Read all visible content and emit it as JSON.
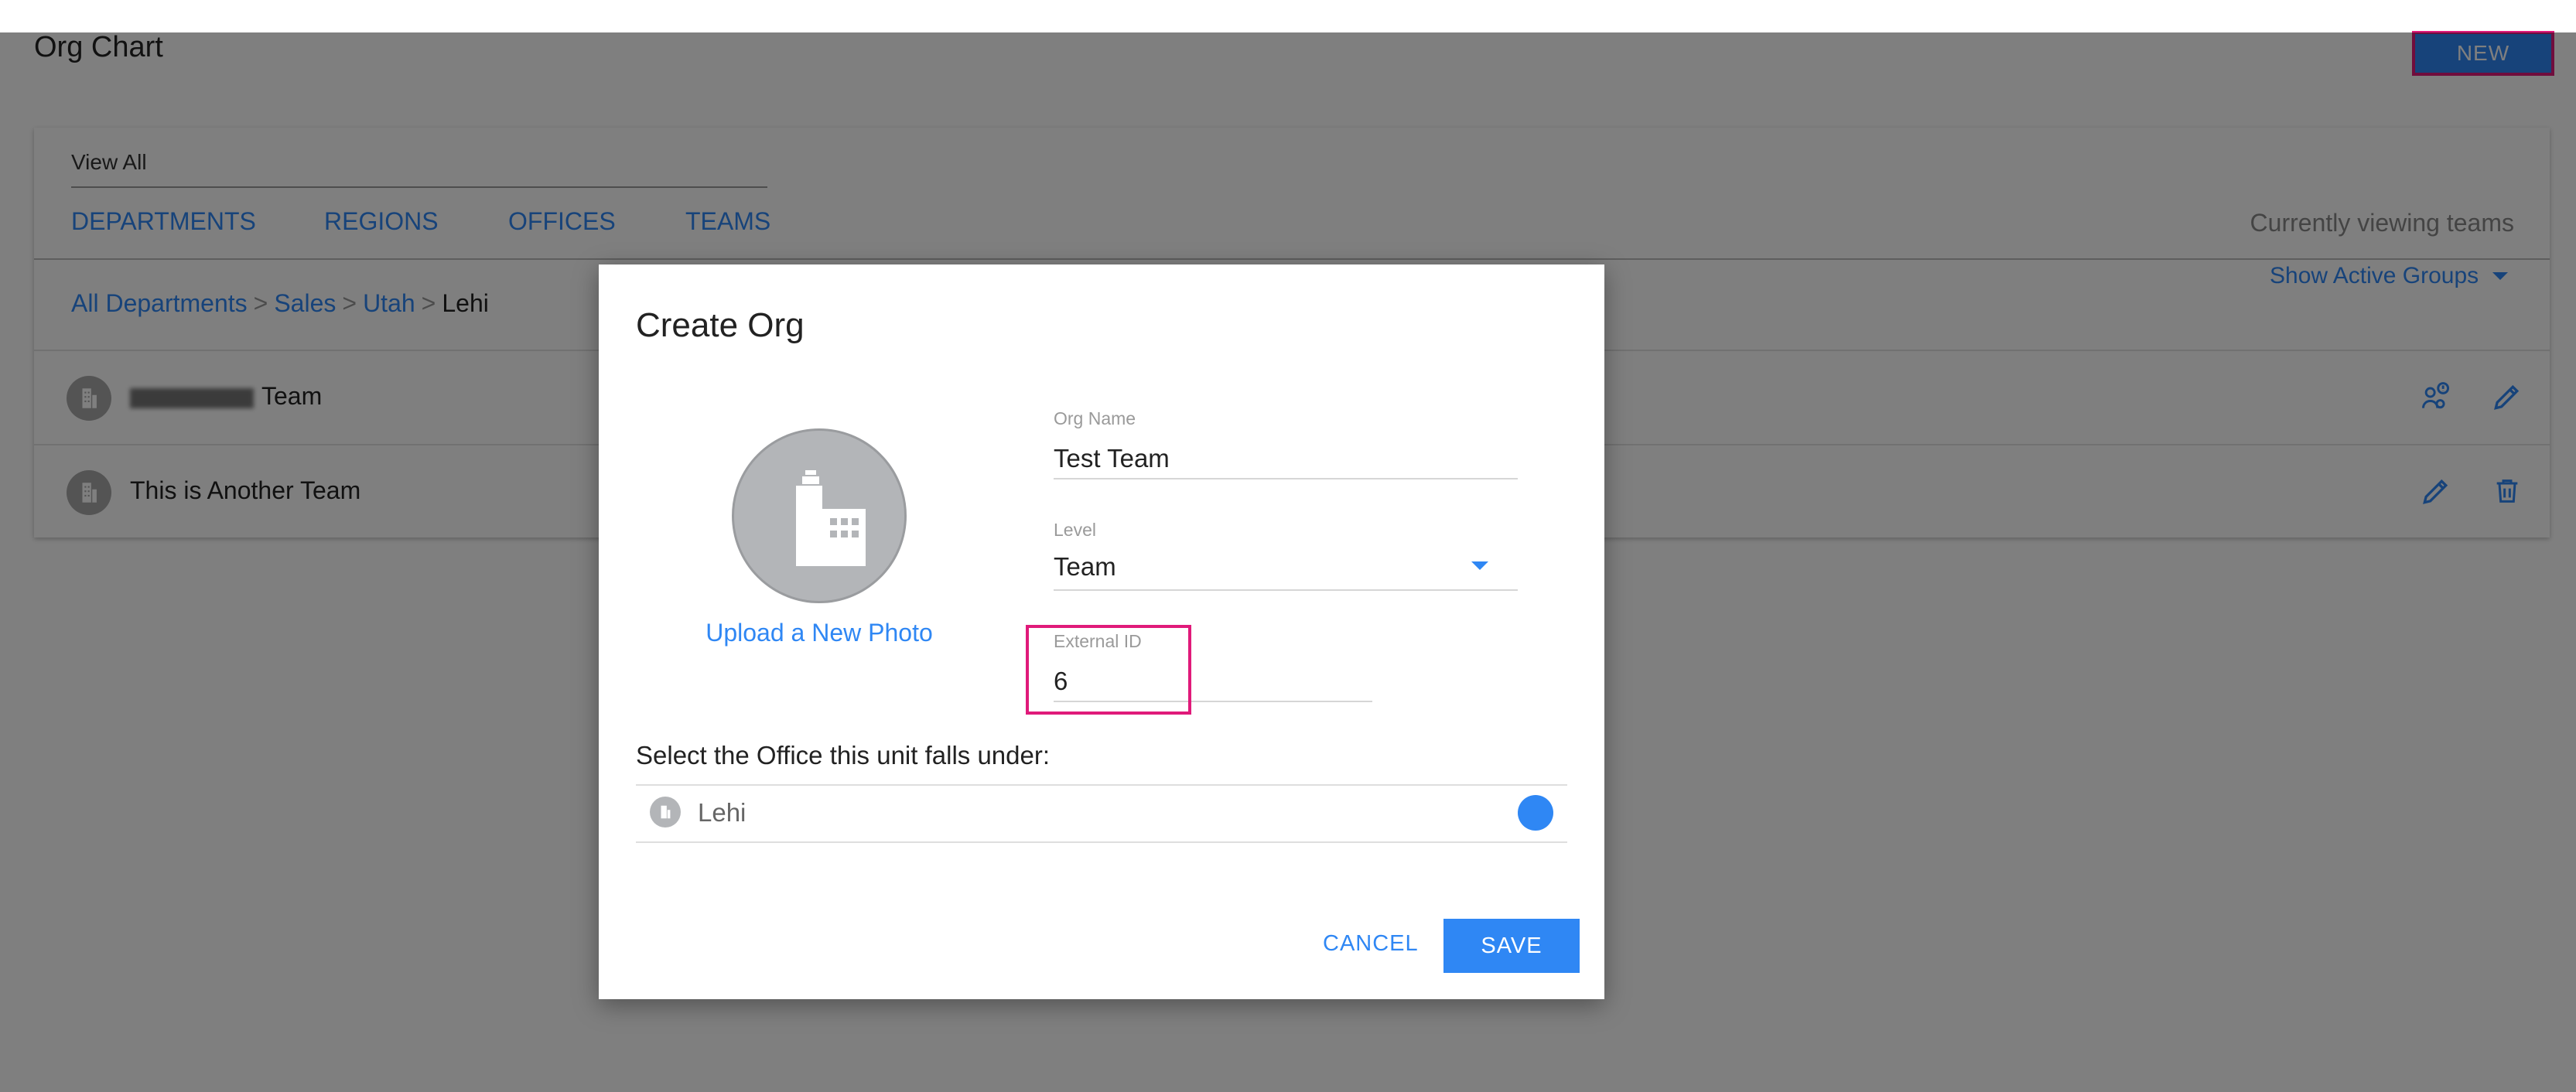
{
  "app": {
    "title": "Org Chart",
    "new_label": "NEW",
    "view_all": "View All",
    "tabs": [
      {
        "label": "DEPARTMENTS"
      },
      {
        "label": "REGIONS"
      },
      {
        "label": "OFFICES"
      },
      {
        "label": "TEAMS"
      }
    ],
    "currently_viewing": "Currently viewing teams",
    "breadcrumb": [
      {
        "label": "All Departments"
      },
      {
        "label": "Sales"
      },
      {
        "label": "Utah"
      },
      {
        "label": "Lehi"
      }
    ],
    "breadcrumb_separator": ">",
    "filter_label": "Show Active Groups",
    "rows": [
      {
        "label": "Team",
        "redacted_prefix": true
      },
      {
        "label": "This is Another Team",
        "redacted_prefix": false
      }
    ]
  },
  "modal": {
    "title": "Create Org",
    "upload_label": "Upload a New Photo",
    "org_name": {
      "label": "Org Name",
      "value": "Test Team"
    },
    "level": {
      "label": "Level",
      "value": "Team"
    },
    "external_id": {
      "label": "External ID",
      "value": "6"
    },
    "office_prompt": "Select the Office this unit falls under:",
    "office": {
      "name": "Lehi",
      "selected": true
    },
    "cancel_label": "CANCEL",
    "save_label": "SAVE"
  },
  "colors": {
    "accent": "#2f87f4",
    "highlight": "#e01a7a",
    "avatar": "#b3b5b8"
  }
}
